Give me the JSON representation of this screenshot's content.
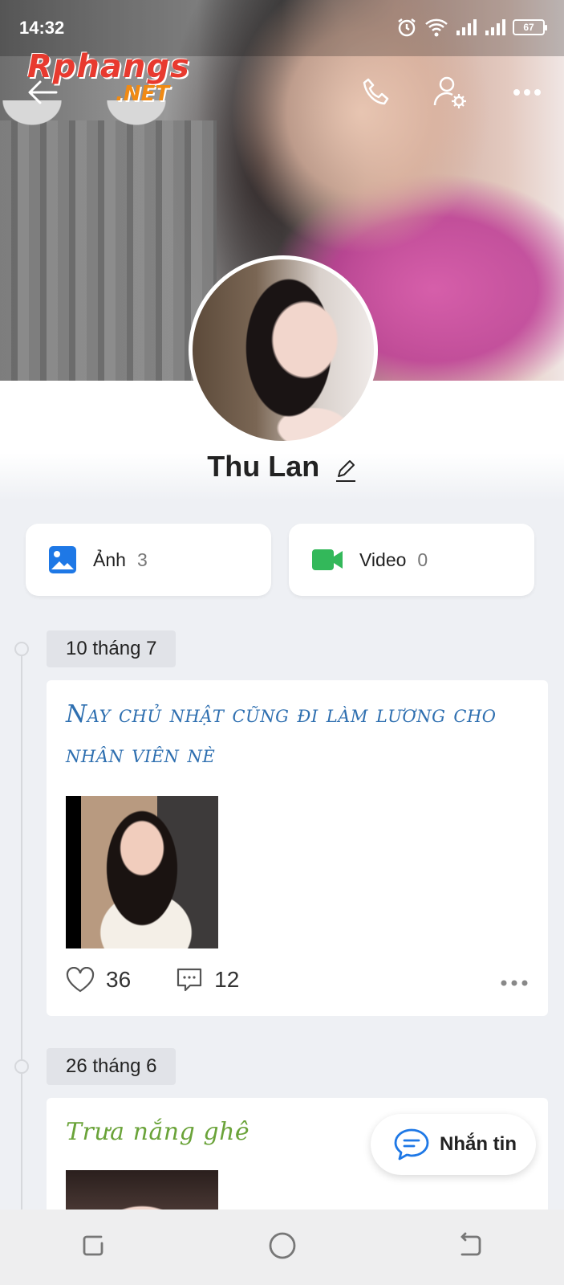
{
  "status_bar": {
    "time": "14:32",
    "battery": "67"
  },
  "watermark": {
    "line1": "Rphangs",
    "line2": ".NET"
  },
  "profile": {
    "name": "Thu Lan"
  },
  "media": {
    "photos": {
      "label": "Ảnh",
      "count": "3"
    },
    "videos": {
      "label": "Video",
      "count": "0"
    }
  },
  "posts": [
    {
      "date": "10 tháng 7",
      "text": "Nay chủ nhật cũng đi làm lương cho nhân viên nè",
      "text_color": "#2e6fb0",
      "likes": "36",
      "comments": "12"
    },
    {
      "date": "26 tháng 6",
      "text": "Trưa nắng ghê",
      "text_color": "#6aa339"
    }
  ],
  "fab": {
    "label": "Nhắn tin"
  },
  "colors": {
    "accent": "#1e78e6",
    "photo_icon": "#1e78e6",
    "video_icon": "#33b85a"
  }
}
